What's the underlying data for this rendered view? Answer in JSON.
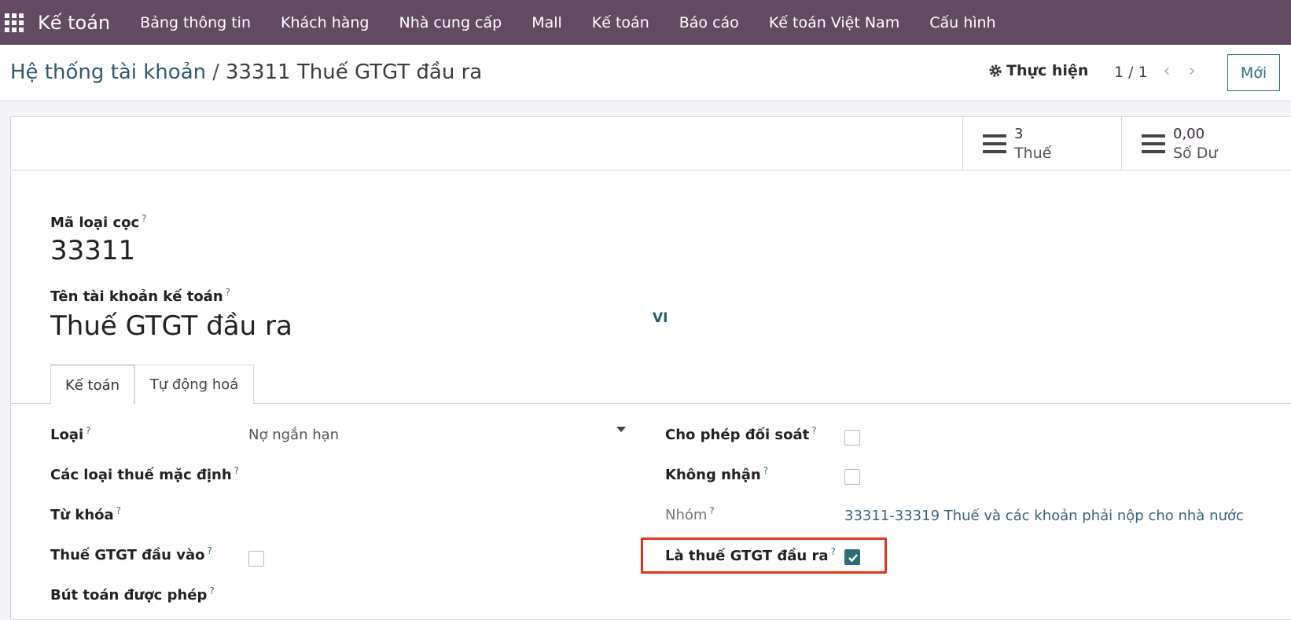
{
  "navbar": {
    "app_name": "Kế toán",
    "items": [
      "Bảng thông tin",
      "Khách hàng",
      "Nhà cung cấp",
      "Mall",
      "Kế toán",
      "Báo cáo",
      "Kế toán Việt Nam",
      "Cấu hình"
    ]
  },
  "control": {
    "breadcrumb_parent": "Hệ thống tài khoản",
    "breadcrumb_sep": "/",
    "breadcrumb_current": "33311 Thuế GTGT đầu ra",
    "action_label": "Thực hiện",
    "pager": "1 / 1",
    "new_label": "Mới"
  },
  "stats": {
    "tax_value": "3",
    "tax_label": "Thuế",
    "balance_value": "0,00",
    "balance_label": "Số Dư"
  },
  "form": {
    "code_label": "Mã loại cọc",
    "code_value": "33311",
    "name_label": "Tên tài khoản kế toán",
    "name_value": "Thuế GTGT đầu ra",
    "lang": "VI",
    "help_mark": "?",
    "tabs": [
      "Kế toán",
      "Tự động hoá"
    ],
    "left_fields": {
      "type_label": "Loại",
      "type_value": "Nợ ngắn hạn",
      "default_taxes_label": "Các loại thuế mặc định",
      "tags_label": "Từ khóa",
      "input_vat_label": "Thuế GTGT đầu vào",
      "allowed_journals_label": "Bút toán được phép"
    },
    "right_fields": {
      "reconcile_label": "Cho phép đối soát",
      "deprecated_label": "Không nhận",
      "group_label": "Nhóm",
      "group_value": "33311-33319 Thuế và các khoản phải nộp cho nhà nước",
      "output_vat_label": "Là thuế GTGT đầu ra"
    },
    "checkboxes": {
      "input_vat": false,
      "reconcile": false,
      "deprecated": false,
      "output_vat": true
    }
  },
  "colors": {
    "navbar": "#624a63",
    "accent": "#2f6e74",
    "highlight": "#e4321b"
  }
}
